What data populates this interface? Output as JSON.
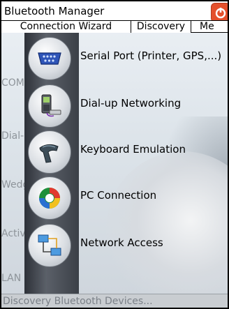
{
  "window": {
    "title": "Bluetooth Manager"
  },
  "tabs": [
    {
      "label": "Connection Wizard"
    },
    {
      "label": "Discovery"
    },
    {
      "label": "Me"
    }
  ],
  "faded_labels": [
    "COM",
    "Dial-",
    "Wedge",
    "ActiveSync",
    "LAN"
  ],
  "items": [
    {
      "label": "Serial Port (Printer, GPS,...)",
      "icon": "serial-port-icon"
    },
    {
      "label": "Dial-up Networking",
      "icon": "phone-icon"
    },
    {
      "label": "Keyboard Emulation",
      "icon": "scanner-icon"
    },
    {
      "label": "PC Connection",
      "icon": "pc-sync-icon"
    },
    {
      "label": "Network Access",
      "icon": "network-icon"
    }
  ],
  "status": {
    "text": "Discovery Bluetooth Devices..."
  },
  "colors": {
    "close_button": "#e4502c",
    "background": "#dde4ea",
    "strip": "#3b4047"
  }
}
